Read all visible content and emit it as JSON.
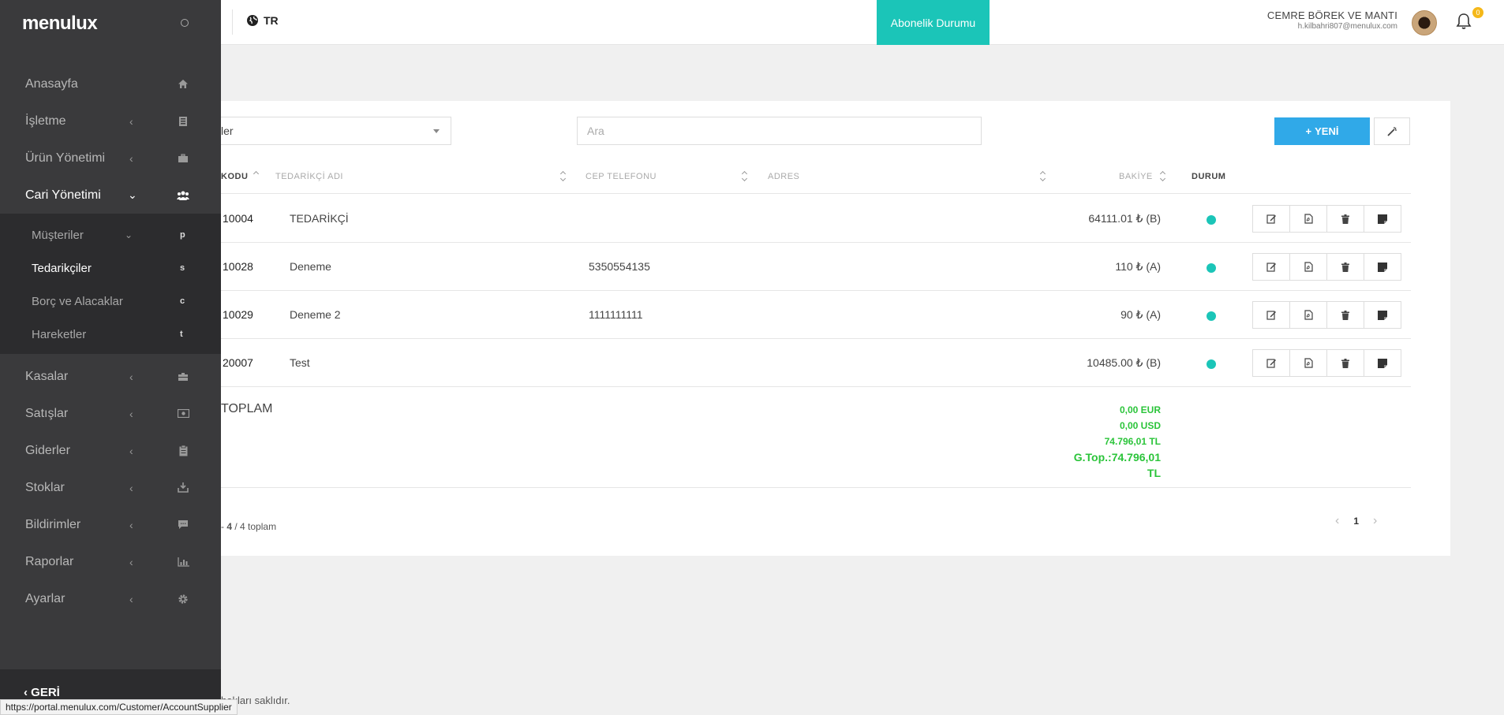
{
  "header": {
    "lang": "TR",
    "subscription_label": "Abonelik Durumu",
    "user_name": "CEMRE BÖREK VE MANTI",
    "user_email": "h.kilbahri807@menulux.com",
    "notification_count": "0"
  },
  "sidebar": {
    "brand": "menulux",
    "items": [
      {
        "label": "Anasayfa",
        "icon": "home-icon"
      },
      {
        "label": "İşletme",
        "icon": "building-icon"
      },
      {
        "label": "Ürün Yönetimi",
        "icon": "briefcase-icon"
      },
      {
        "label": "Cari Yönetimi",
        "icon": "users-icon"
      }
    ],
    "sub_items": [
      {
        "label": "Müşteriler",
        "letter": "p"
      },
      {
        "label": "Tedarikçiler",
        "letter": "s"
      },
      {
        "label": "Borç ve Alacaklar",
        "letter": "c"
      },
      {
        "label": "Hareketler",
        "letter": "t"
      }
    ],
    "items_after": [
      {
        "label": "Kasalar",
        "icon": "cash-register-icon"
      },
      {
        "label": "Satışlar",
        "icon": "money-icon"
      },
      {
        "label": "Giderler",
        "icon": "clipboard-icon"
      },
      {
        "label": "Stoklar",
        "icon": "download-box-icon"
      },
      {
        "label": "Bildirimler",
        "icon": "message-icon"
      },
      {
        "label": "Raporlar",
        "icon": "bar-chart-icon"
      },
      {
        "label": "Ayarlar",
        "icon": "gear-icon"
      }
    ],
    "back_label": "GERİ"
  },
  "toolbar": {
    "select_value": "ler",
    "search_placeholder": "Ara",
    "new_label": "YENİ"
  },
  "table": {
    "columns": [
      "KODU",
      "TEDARİKÇİ ADI",
      "CEP TELEFONU",
      "ADRES",
      "BAKİYE",
      "DURUM"
    ],
    "rows": [
      {
        "kod": "10004",
        "ad": "TEDARİKÇİ",
        "tel": "",
        "bakiye": "64111.01 ₺ (B)"
      },
      {
        "kod": "10028",
        "ad": "Deneme",
        "tel": "5350554135",
        "bakiye": "110 ₺ (A)"
      },
      {
        "kod": "10029",
        "ad": "Deneme 2",
        "tel": "1111111111",
        "bakiye": "90 ₺ (A)"
      },
      {
        "kod": "20007",
        "ad": "Test",
        "tel": "",
        "bakiye": "10485.00 ₺ (B)"
      }
    ],
    "total_label": "TOPLAM",
    "totals": {
      "eur": "0,00 EUR",
      "usd": "0,00 USD",
      "tl": "74.796,01 TL",
      "grand_1": "G.Top.:74.796,01",
      "grand_2": "TL"
    }
  },
  "pagination": {
    "info_prefix": "- ",
    "info_bold": "4",
    "info_suffix": " / 4 toplam",
    "current_page": "1"
  },
  "footer": {
    "text": "hakları saklıdır."
  },
  "status_url": "https://portal.menulux.com/Customer/AccountSupplier",
  "colors": {
    "accent": "#1bc5b8",
    "primary": "#30a9e8",
    "total_green": "#2bc43a",
    "sidebar": "#3a3a3c"
  }
}
